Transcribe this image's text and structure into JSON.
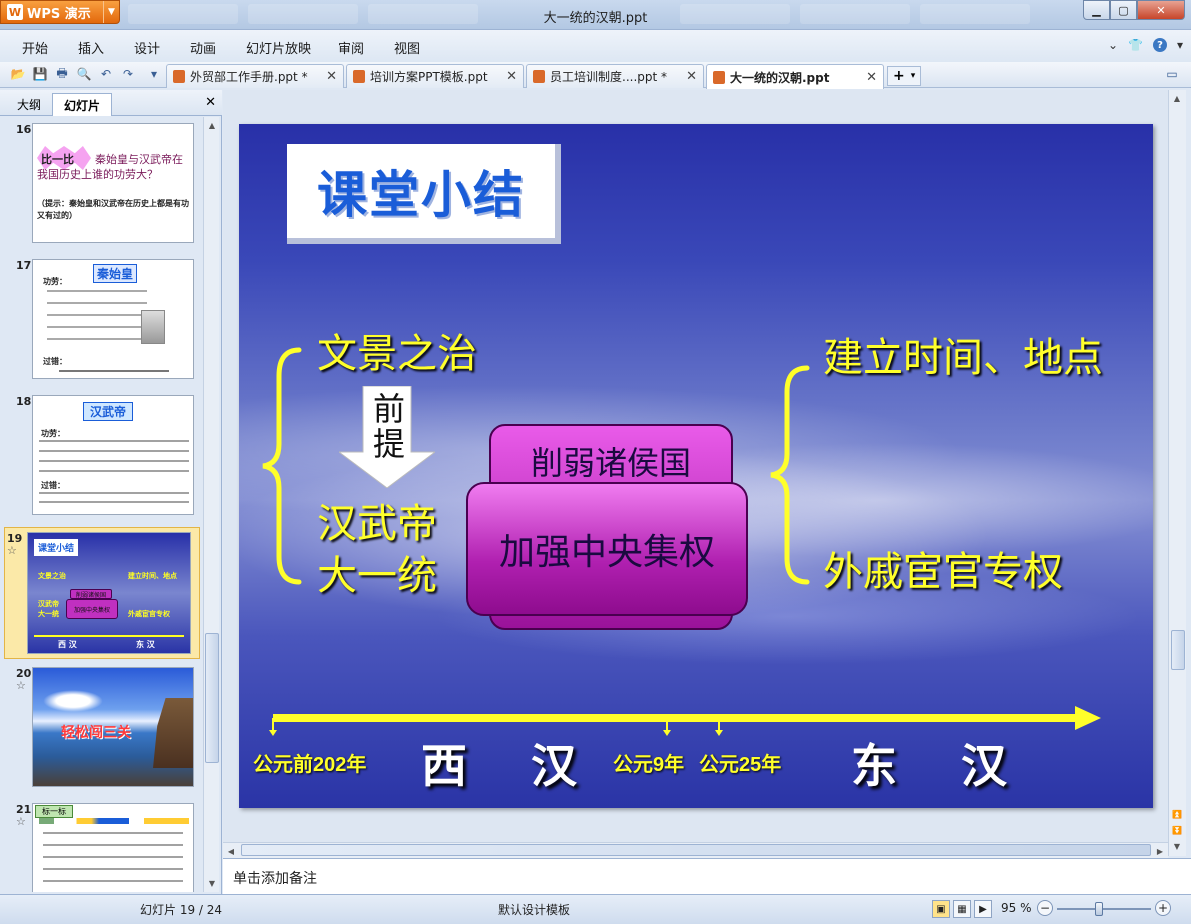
{
  "app": {
    "logo_text": "WPS 演示",
    "doc_title": "大一统的汉朝.ppt"
  },
  "menu": [
    "开始",
    "插入",
    "设计",
    "动画",
    "幻灯片放映",
    "审阅",
    "视图"
  ],
  "doc_tabs": [
    {
      "label": "外贸部工作手册.ppt *"
    },
    {
      "label": "培训方案PPT模板.ppt"
    },
    {
      "label": "员工培训制度....ppt *"
    },
    {
      "label": "大一统的汉朝.ppt",
      "active": true
    }
  ],
  "left_pane": {
    "tabs": [
      "大纲",
      "幻灯片"
    ],
    "slides": [
      {
        "num": "16",
        "title": "比一比",
        "text": "秦始皇与汉武帝在我国历史上谁的功劳大？",
        "hint": "（提示：秦始皇和汉武帝在历史上都是有功又有过的）"
      },
      {
        "num": "17",
        "title": "秦始皇",
        "bullets": [
          "功劳：",
          "过错："
        ]
      },
      {
        "num": "18",
        "title": "汉武帝",
        "bullets": [
          "功劳：",
          "过错："
        ]
      },
      {
        "num": "19",
        "star": "☆",
        "title": "课堂小结",
        "selected": true,
        "labels": [
          "文景之治",
          "建立时间、地点",
          "削弱诸侯国",
          "汉武帝",
          "大一统",
          "加强中央集权",
          "外戚宦官专权",
          "西 汉",
          "东 汉"
        ]
      },
      {
        "num": "20",
        "star": "☆",
        "title": "轻松闯三关"
      },
      {
        "num": "21",
        "star": "☆",
        "title": "标一标"
      }
    ]
  },
  "slide": {
    "title": "课堂小结",
    "left_top": "文景之治",
    "arrow_text": [
      "前",
      "提"
    ],
    "left_bottom_1": "汉武帝",
    "left_bottom_2": "大一统",
    "box_back": "削弱诸侯国",
    "box_front": "加强中央集权",
    "right_top": "建立时间、地点",
    "right_bottom": "外戚宦官专权",
    "timeline": {
      "start": "公元前202年",
      "era1": "西 汉",
      "mid1": "公元9年",
      "mid2": "公元25年",
      "era2": "东 汉"
    }
  },
  "notes_placeholder": "单击添加备注",
  "status": {
    "slide_info": "幻灯片 19 / 24",
    "template": "默认设计模板",
    "zoom": "95 %"
  },
  "colors": {
    "slide_yellow": "#ffff2a",
    "title_blue": "#1a5dd8",
    "box_magenta": "#b020b0",
    "selected_thumb": "#fbe9a8"
  }
}
